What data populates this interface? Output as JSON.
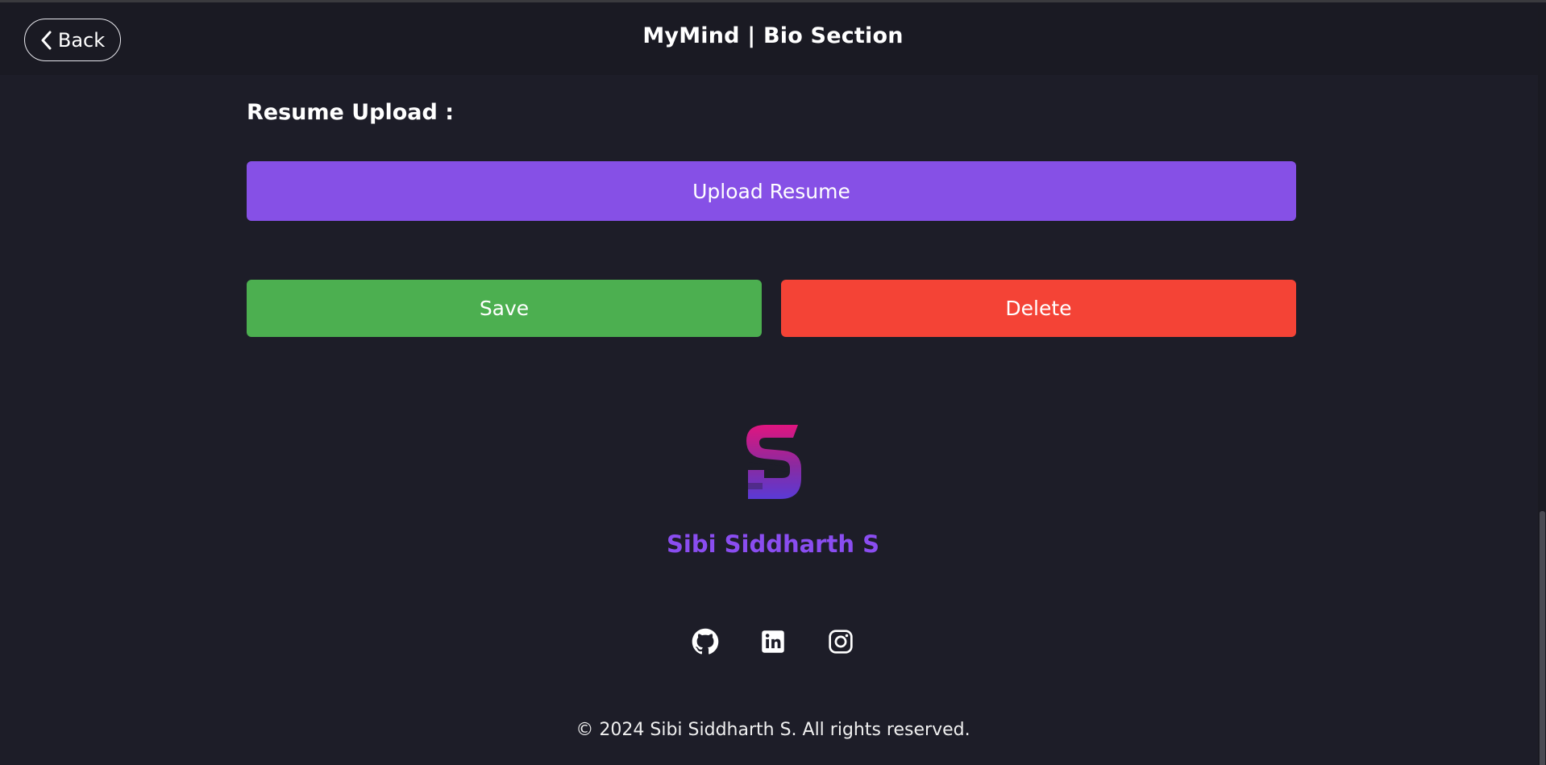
{
  "header": {
    "back_label": "Back",
    "title": "MyMind | Bio Section"
  },
  "resume": {
    "section_label": "Resume Upload :",
    "upload_label": "Upload Resume"
  },
  "actions": {
    "save_label": "Save",
    "delete_label": "Delete"
  },
  "footer": {
    "logo_letter": "S",
    "brand_name": "Sibi Siddharth S",
    "social": [
      {
        "icon": "github-icon"
      },
      {
        "icon": "linkedin-icon"
      },
      {
        "icon": "instagram-icon"
      }
    ],
    "copyright": "© 2024 Sibi Siddharth S. All rights reserved."
  },
  "colors": {
    "background": "#1d1d28",
    "accent_purple": "#8650e6",
    "save_green": "#4caf50",
    "delete_red": "#f44336",
    "brand_text": "#8a4df0",
    "logo_gradient_top": "#e0157f",
    "logo_gradient_bottom": "#5a3ad6"
  }
}
